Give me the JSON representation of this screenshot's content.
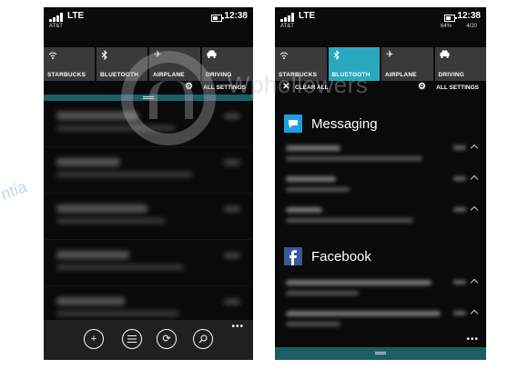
{
  "left_phone": {
    "status": {
      "network": "LTE",
      "carrier": "AT&T",
      "time": "12:38"
    },
    "quick_actions": [
      {
        "label": "STARBUCKS",
        "icon": "wifi-icon",
        "active": false
      },
      {
        "label": "BLUETOOTH",
        "icon": "bluetooth-icon",
        "active": false
      },
      {
        "label": "AIRPLANE",
        "icon": "airplane-icon",
        "active": false
      },
      {
        "label": "DRIVING",
        "icon": "car-icon",
        "active": false
      }
    ],
    "all_settings_label": "ALL SETTINGS",
    "app_bar_buttons": [
      "add-icon",
      "list-icon",
      "sync-icon",
      "search-icon"
    ]
  },
  "right_phone": {
    "status": {
      "network": "LTE",
      "carrier": "AT&T",
      "time": "12:38",
      "battery": "64%",
      "date": "4/20"
    },
    "quick_actions": [
      {
        "label": "STARBUCKS",
        "icon": "wifi-icon",
        "active": false
      },
      {
        "label": "BLUETOOTH",
        "icon": "bluetooth-icon",
        "active": true
      },
      {
        "label": "AIRPLANE",
        "icon": "airplane-icon",
        "active": false
      },
      {
        "label": "DRIVING",
        "icon": "car-icon",
        "active": false
      }
    ],
    "clear_all_label": "CLEAR ALL",
    "all_settings_label": "ALL SETTINGS",
    "groups": [
      {
        "title": "Messaging",
        "icon": "messaging-icon",
        "color": "#1ba1e2"
      },
      {
        "title": "Facebook",
        "icon": "facebook-icon",
        "color": "#3b5998"
      }
    ]
  },
  "watermark": {
    "text": "Wphollowers"
  },
  "colors": {
    "accent": "#2aa8bf",
    "tile": "#3a3a3a",
    "teal_bar": "#1b5e66",
    "background": "#0a0a0a"
  }
}
